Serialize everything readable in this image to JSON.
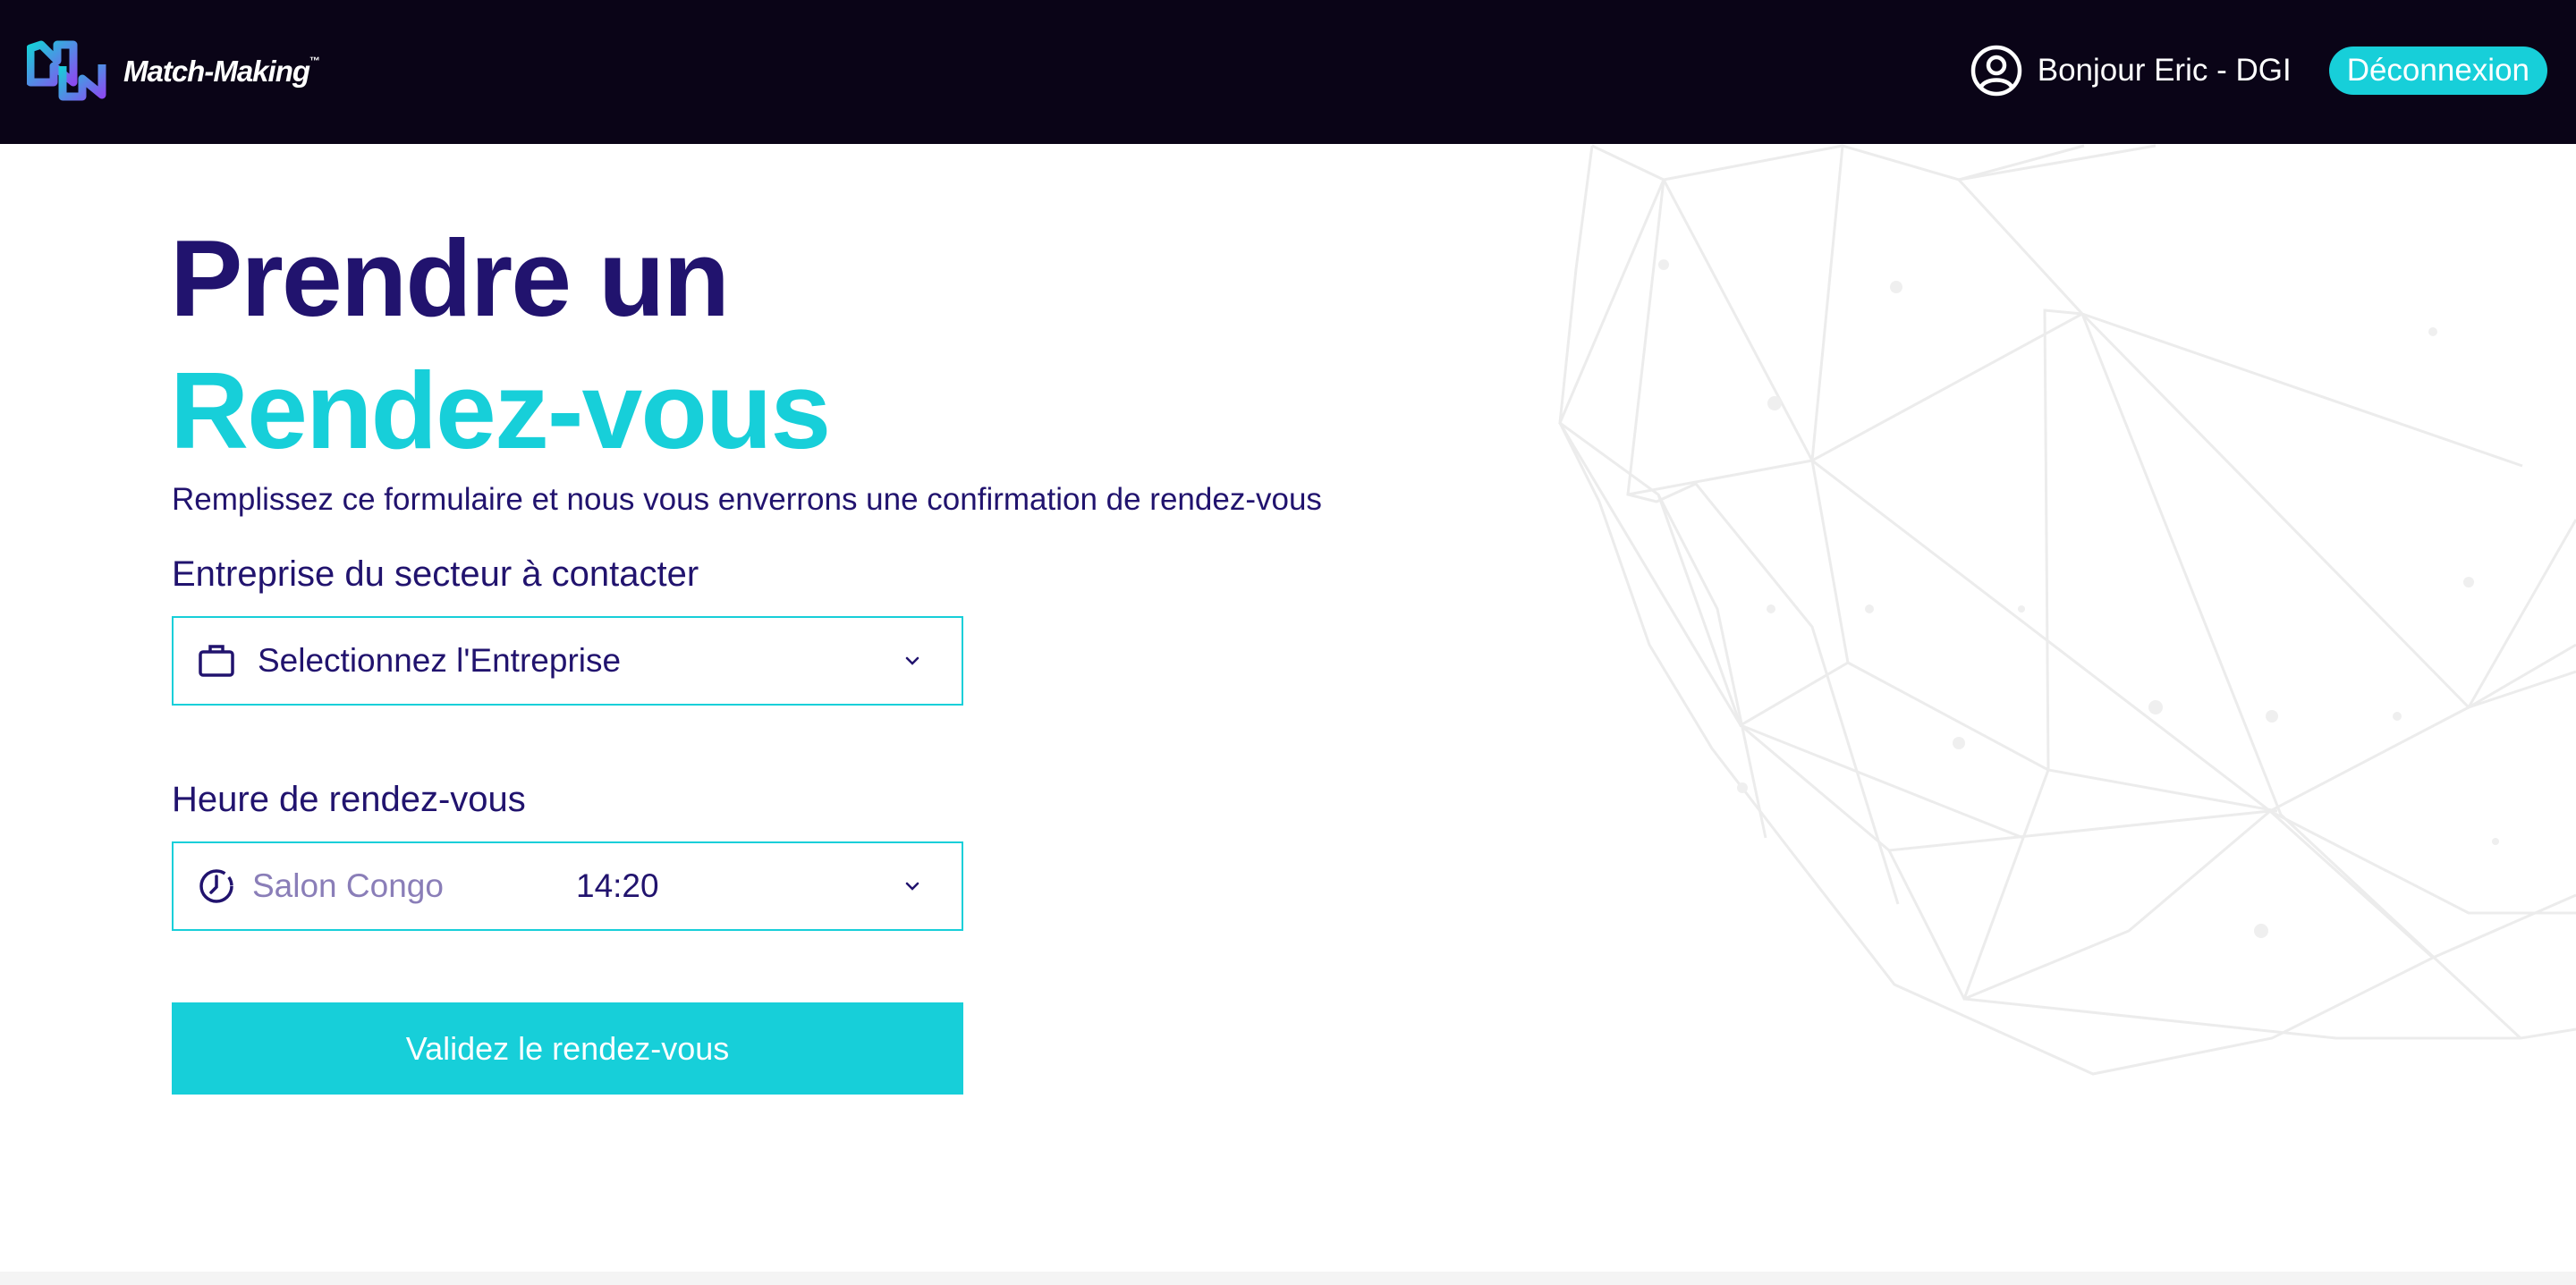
{
  "header": {
    "logo_text": "Match-Making",
    "logo_tm": "™",
    "greeting": "Bonjour Eric - DGI",
    "logout_label": "Déconnexion"
  },
  "main": {
    "title_line1": "Prendre un",
    "title_line2": "Rendez-vous",
    "subtitle": "Remplissez ce formulaire et nous vous enverrons une confirmation de rendez-vous",
    "company_field": {
      "label": "Entreprise du secteur à contacter",
      "value": "Selectionnez l'Entreprise"
    },
    "time_field": {
      "label": "Heure de rendez-vous",
      "location": "Salon Congo",
      "time": "14:20"
    },
    "submit_label": "Validez le rendez-vous"
  },
  "colors": {
    "header_bg": "#0a0417",
    "brand_dark": "#21136e",
    "accent_cyan": "#17cfd9",
    "placeholder": "#8a7eb8"
  },
  "icons": [
    "logo-icon",
    "user-circle-icon",
    "briefcase-icon",
    "clock-icon",
    "chevron-down-icon"
  ]
}
